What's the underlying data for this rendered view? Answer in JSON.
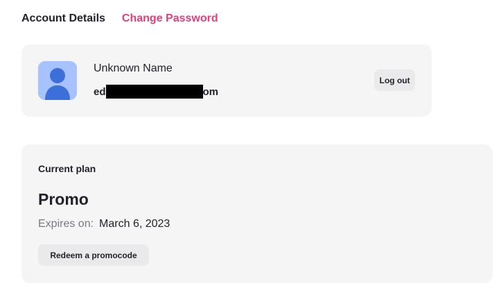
{
  "tabs": {
    "account_details": "Account Details",
    "change_password": "Change Password"
  },
  "profile": {
    "name": "Unknown Name",
    "email_prefix": "ed",
    "email_suffix": "om",
    "logout_label": "Log out",
    "avatar_icon": "user-avatar-icon"
  },
  "plan": {
    "label": "Current plan",
    "name": "Promo",
    "expires_label": "Expires on:",
    "expires_value": "March 6, 2023",
    "redeem_label": "Redeem a promocode"
  },
  "colors": {
    "accent": "#e0407f",
    "card_bg": "#f5f5f6",
    "avatar_bg": "#a8c1ff",
    "avatar_fg": "#3d6fd9"
  }
}
